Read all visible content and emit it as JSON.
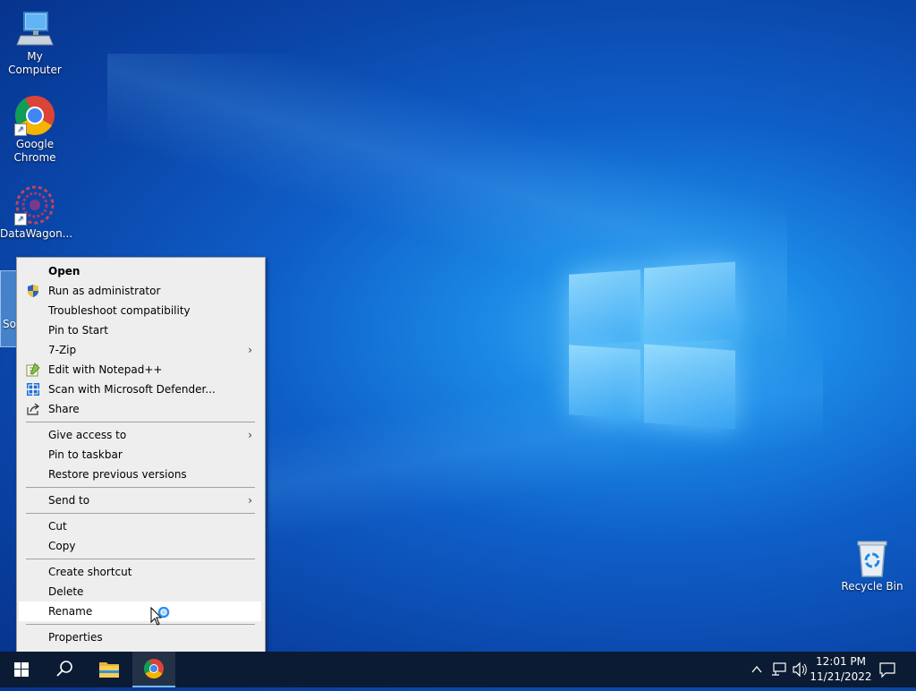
{
  "desktop": {
    "icons": [
      {
        "label": "My Computer"
      },
      {
        "label": "Google Chrome"
      },
      {
        "label": "DataWagon..."
      },
      {
        "label": "Recycle Bin"
      }
    ],
    "selected_partial_label": "So a"
  },
  "context_menu": {
    "items": [
      {
        "label": "Open"
      },
      {
        "label": "Run as administrator"
      },
      {
        "label": "Troubleshoot compatibility"
      },
      {
        "label": "Pin to Start"
      },
      {
        "label": "7-Zip"
      },
      {
        "label": "Edit with Notepad++"
      },
      {
        "label": "Scan with Microsoft Defender..."
      },
      {
        "label": "Share"
      },
      {
        "label": "Give access to"
      },
      {
        "label": "Pin to taskbar"
      },
      {
        "label": "Restore previous versions"
      },
      {
        "label": "Send to"
      },
      {
        "label": "Cut"
      },
      {
        "label": "Copy"
      },
      {
        "label": "Create shortcut"
      },
      {
        "label": "Delete"
      },
      {
        "label": "Rename"
      },
      {
        "label": "Properties"
      }
    ],
    "highlighted": "Rename"
  },
  "taskbar": {
    "time": "12:01 PM",
    "date": "11/21/2022"
  },
  "colors": {
    "taskbar_bg": "#0b1b33",
    "menu_bg": "#eeeeee",
    "accent": "#0078d7"
  }
}
